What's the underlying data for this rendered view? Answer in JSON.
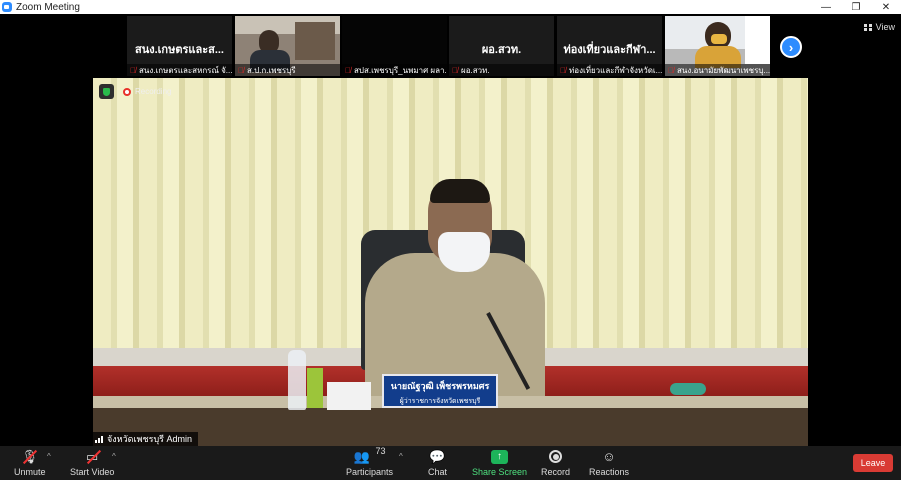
{
  "window": {
    "title": "Zoom Meeting",
    "controls": [
      "—",
      "❐",
      "✕"
    ]
  },
  "strip": {
    "tiles": [
      {
        "big_name": "สนง.เกษตรและส...",
        "caption": "สนง.เกษตรและสหกรณ์ จั..."
      },
      {
        "big_name": "",
        "caption": "ส.ป.ก.เพชรบุรี"
      },
      {
        "big_name": "",
        "caption": "สปส.เพชรบุรี_นพมาศ ผลา..."
      },
      {
        "big_name": "ผอ.สวท.",
        "caption": "ผอ.สวท."
      },
      {
        "big_name": "ท่องเที่ยวและกีฬา...",
        "caption": "ท่องเที่ยวและกีฬาจังหวัดเ..."
      },
      {
        "big_name": "",
        "caption": "สนง.อนามัยพัฒนาเพชรบุ..."
      }
    ],
    "next_glyph": "›",
    "view_label": "View"
  },
  "main": {
    "recording_label": "Recording",
    "speaker_name": "จังหวัดเพชรบุรี Admin",
    "nameplate_line1": "นายณัฐวุฒิ เพ็ชรพรหมศร",
    "nameplate_line2": "ผู้ว่าราชการจังหวัดเพชรบุรี"
  },
  "toolbar": {
    "unmute": "Unmute",
    "start_video": "Start Video",
    "participants": "Participants",
    "participants_count": "73",
    "chat": "Chat",
    "share_screen": "Share Screen",
    "record": "Record",
    "reactions": "Reactions",
    "leave": "Leave"
  },
  "colors": {
    "accent": "#2d8cff",
    "share_green": "#1db45a",
    "leave_red": "#d93b34",
    "mic_muted": "#e02828"
  }
}
